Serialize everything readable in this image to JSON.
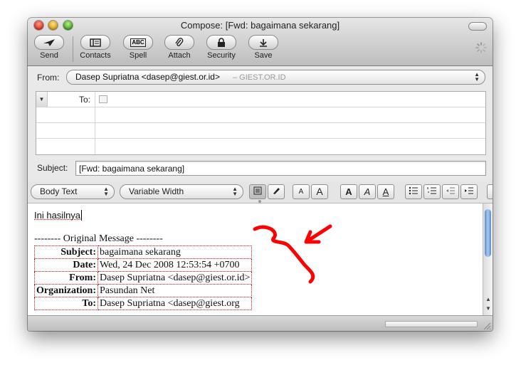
{
  "window": {
    "title": "Compose: [Fwd: bagaimana sekarang]"
  },
  "toolbar": {
    "send": "Send",
    "contacts": "Contacts",
    "spell": "Spell",
    "spell_glyph": "ABC",
    "attach": "Attach",
    "security": "Security",
    "save": "Save"
  },
  "header": {
    "from_label": "From:",
    "from_value": "Dasep Supriatna <dasep@giest.or.id>",
    "from_account": "– GIEST.OR.ID",
    "to_label": "To:",
    "subject_label": "Subject:",
    "subject_value": "[Fwd: bagaimana sekarang]"
  },
  "format_bar": {
    "paragraph_style": "Body Text",
    "font_family": "Variable Width",
    "smaller_glyph": "A",
    "larger_glyph": "A",
    "bold_glyph": "A",
    "italic_glyph": "A",
    "underline_glyph": "A"
  },
  "message": {
    "first_line": "Ini hasilnya",
    "original_marker": "-------- Original Message --------",
    "headers": [
      {
        "key": "Subject:",
        "value": "bagaimana sekarang"
      },
      {
        "key": "Date:",
        "value": "Wed, 24 Dec 2008 12:53:54 +0700"
      },
      {
        "key": "From:",
        "value": "Dasep Supriatna <dasep@giest.or.id>"
      },
      {
        "key": "Organization:",
        "value": "Pasundan Net"
      },
      {
        "key": "To:",
        "value": "Dasep Supriatna <dasep@giest.org"
      }
    ]
  },
  "colors": {
    "annotation": "#ff0000",
    "header_border": "#cc1111",
    "scroll_thumb": "#5a8ccd"
  }
}
